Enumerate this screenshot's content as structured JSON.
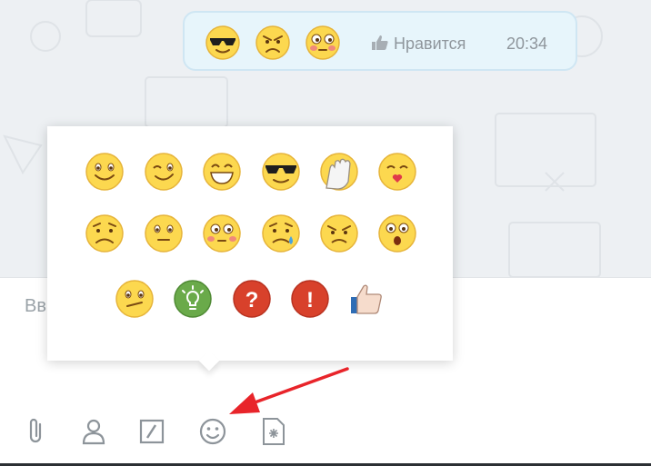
{
  "message": {
    "reactions": [
      "sunglasses-face",
      "angry-face",
      "blushing-face"
    ],
    "like_label": "Нравится",
    "time": "20:34"
  },
  "composer": {
    "placeholder_visible": "Вв"
  },
  "toolbar": {
    "tools": [
      "paperclip-icon",
      "contact-icon",
      "edit-icon",
      "smiley-icon",
      "file-icon"
    ]
  },
  "emoji_picker": {
    "rows": [
      [
        "smile",
        "wink",
        "grin",
        "sunglasses",
        "facepalm",
        "kiss"
      ],
      [
        "worried",
        "neutral",
        "blushing",
        "crying",
        "angry",
        "surprised"
      ],
      [
        "confused",
        "idea",
        "question",
        "exclamation",
        "thumbs-up"
      ]
    ]
  },
  "colors": {
    "emoji_yellow": "#fcd84f",
    "bubble_bg": "#e7f5fb",
    "idea_green": "#6aaa4a",
    "alert_red": "#d8412b",
    "annotation_arrow": "#e8242a"
  }
}
